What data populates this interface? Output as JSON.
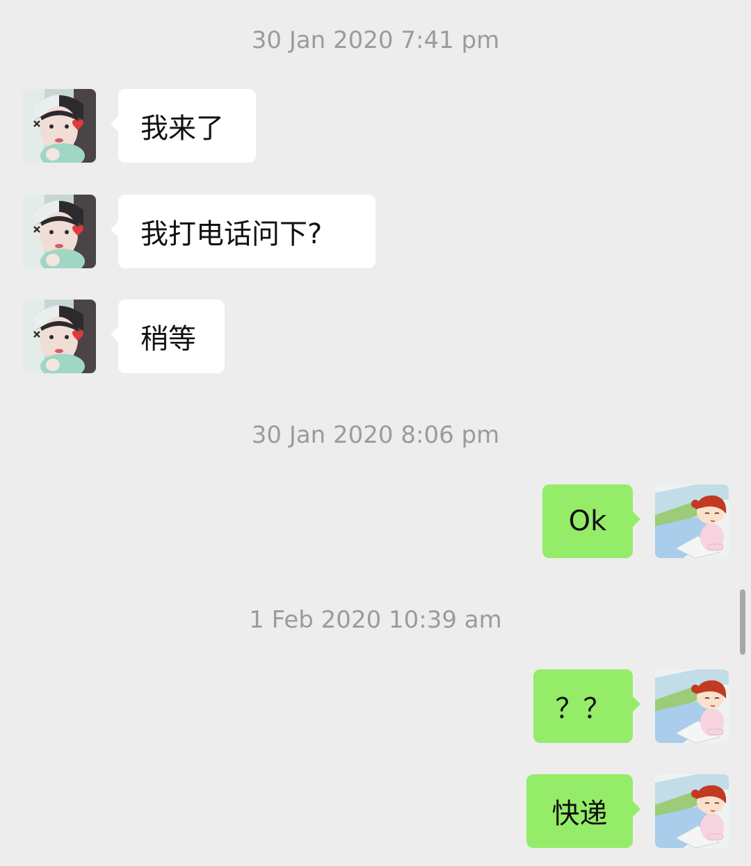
{
  "chat": {
    "timestamps": [
      "30 Jan 2020 7:41 pm",
      "30 Jan 2020 8:06 pm",
      "1 Feb 2020 10:39 am"
    ],
    "incoming": [
      {
        "text": "我来了"
      },
      {
        "text": "我打电话问下?"
      },
      {
        "text": "稍等"
      }
    ],
    "outgoing": [
      {
        "text": "Ok"
      },
      {
        "text": "？？"
      },
      {
        "text": "快递"
      }
    ]
  },
  "colors": {
    "background": "#ededed",
    "incoming_bubble": "#ffffff",
    "outgoing_bubble": "#95ec69",
    "timestamp_text": "#9b9b9b",
    "message_text": "#111111"
  },
  "icons": {
    "contact_avatar": "contact-avatar-icon",
    "self_avatar": "self-avatar-icon"
  }
}
